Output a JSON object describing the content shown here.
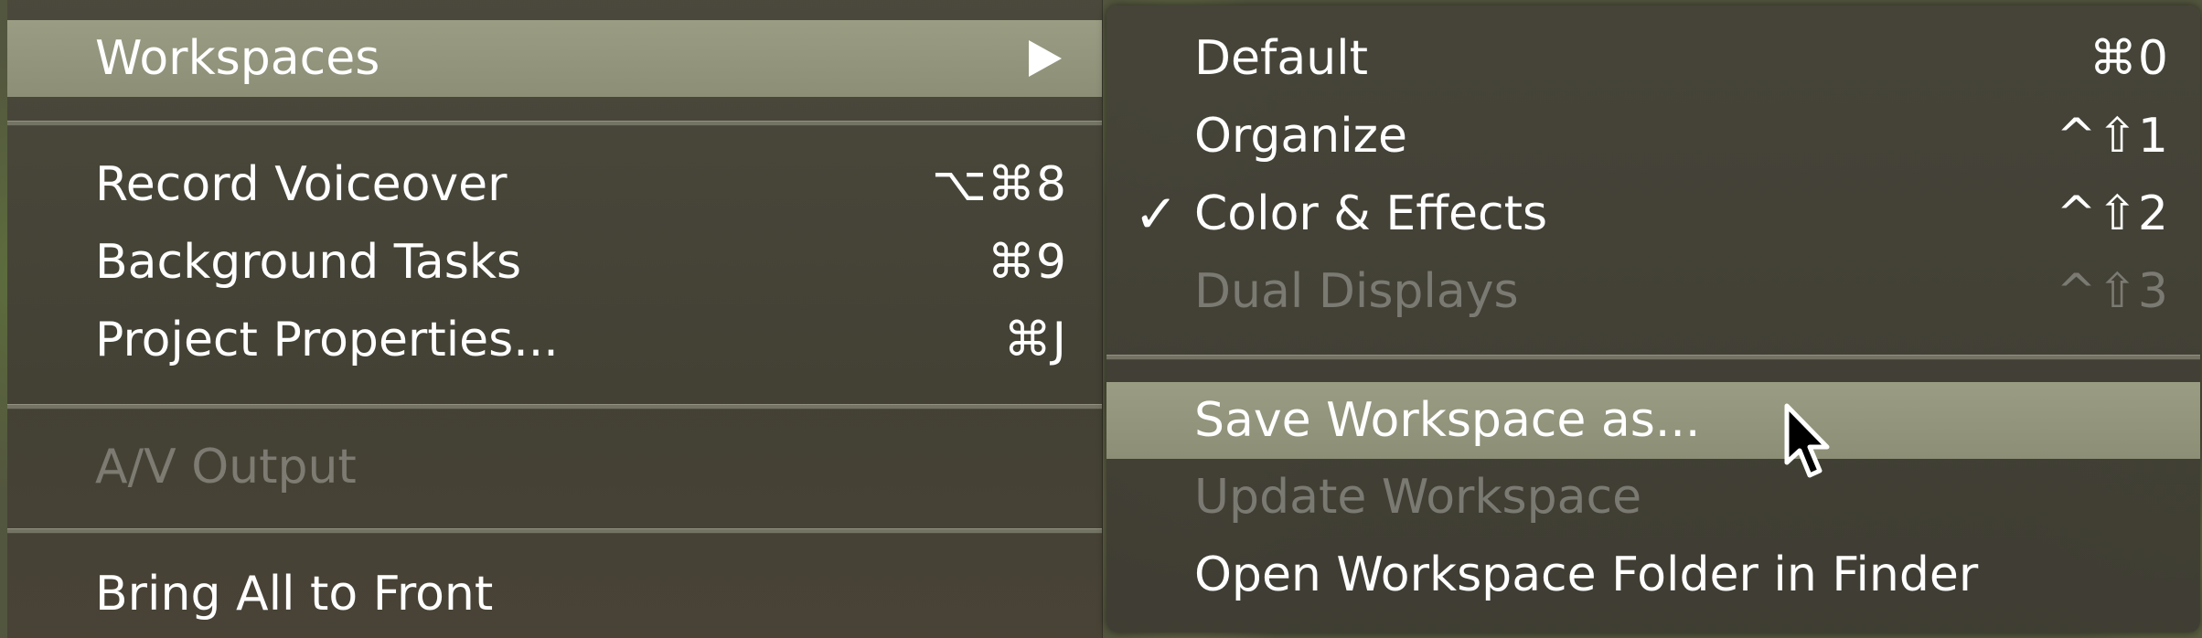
{
  "main_menu": {
    "items": [
      {
        "label": "Workspaces",
        "shortcut": ""
      },
      {
        "label": "Record Voiceover",
        "shortcut": "⌥⌘8"
      },
      {
        "label": "Background Tasks",
        "shortcut": "⌘9"
      },
      {
        "label": "Project Properties...",
        "shortcut": "⌘J"
      },
      {
        "label": "A/V Output",
        "shortcut": ""
      },
      {
        "label": "Bring All to Front",
        "shortcut": ""
      }
    ]
  },
  "submenu": {
    "items": [
      {
        "label": "Default",
        "shortcut": "⌘0"
      },
      {
        "label": "Organize",
        "shortcut": "^⇧1"
      },
      {
        "label": "Color & Effects",
        "shortcut": "^⇧2",
        "checked": "✓"
      },
      {
        "label": "Dual Displays",
        "shortcut": "^⇧3"
      },
      {
        "label": "Save Workspace as...",
        "shortcut": ""
      },
      {
        "label": "Update Workspace",
        "shortcut": ""
      },
      {
        "label": "Open Workspace Folder in Finder",
        "shortcut": ""
      }
    ]
  },
  "colors": {
    "highlight": "#9a9c83",
    "menu_bg": "#46443a",
    "text": "#ffffff",
    "disabled_text": "rgba(255,255,255,0.30)"
  },
  "icons": {
    "submenu_arrow": "triangle-right-icon",
    "checkmark": "checkmark-icon",
    "cursor": "mouse-pointer-icon"
  }
}
